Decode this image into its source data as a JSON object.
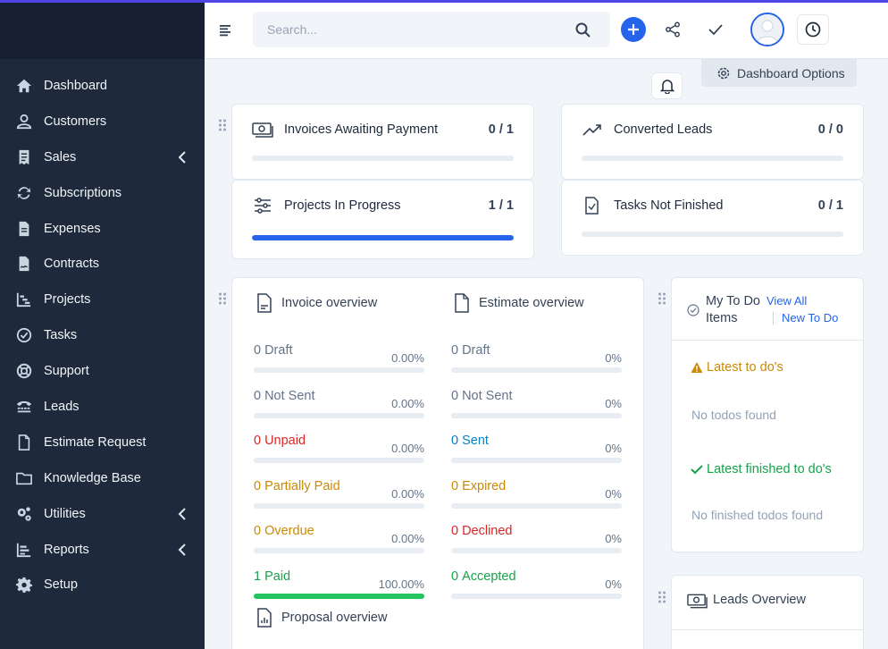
{
  "colors": {
    "sidebar": "#1e293b",
    "accent": "#2563eb",
    "danger": "#dc2626",
    "warning": "#ca8a04",
    "info": "#0284c7",
    "success": "#16a34a"
  },
  "sidebar": {
    "items": [
      {
        "label": "Dashboard",
        "icon": "home-icon"
      },
      {
        "label": "Customers",
        "icon": "user-icon"
      },
      {
        "label": "Sales",
        "icon": "receipt-icon",
        "submenu": true
      },
      {
        "label": "Subscriptions",
        "icon": "refresh-icon"
      },
      {
        "label": "Expenses",
        "icon": "file-icon"
      },
      {
        "label": "Contracts",
        "icon": "contract-icon"
      },
      {
        "label": "Projects",
        "icon": "chart-icon"
      },
      {
        "label": "Tasks",
        "icon": "check-circle-icon"
      },
      {
        "label": "Support",
        "icon": "lifebuoy-icon"
      },
      {
        "label": "Leads",
        "icon": "tty-icon"
      },
      {
        "label": "Estimate Request",
        "icon": "document-icon"
      },
      {
        "label": "Knowledge Base",
        "icon": "folder-icon"
      },
      {
        "label": "Utilities",
        "icon": "cogs-icon",
        "submenu": true
      },
      {
        "label": "Reports",
        "icon": "chart-bar-icon",
        "submenu": true
      },
      {
        "label": "Setup",
        "icon": "gear-icon"
      }
    ]
  },
  "topbar": {
    "search_placeholder": "Search..."
  },
  "dashboard_options": "Dashboard Options",
  "stats": [
    {
      "title": "Invoices Awaiting Payment",
      "value": "0 / 1",
      "progress": 0
    },
    {
      "title": "Converted Leads",
      "value": "0 / 0",
      "progress": 0
    },
    {
      "title": "Projects In Progress",
      "value": "1 / 1",
      "progress": 100
    },
    {
      "title": "Tasks Not Finished",
      "value": "0 / 1",
      "progress": 0
    }
  ],
  "invoice_overview": {
    "title": "Invoice overview",
    "rows": [
      {
        "count": "0",
        "label": "Draft",
        "pct": "0.00%",
        "progress": 0
      },
      {
        "count": "0",
        "label": "Not Sent",
        "pct": "0.00%",
        "progress": 0
      },
      {
        "count": "0",
        "label": "Unpaid",
        "pct": "0.00%",
        "progress": 0
      },
      {
        "count": "0",
        "label": "Partially Paid",
        "pct": "0.00%",
        "progress": 0
      },
      {
        "count": "0",
        "label": "Overdue",
        "pct": "0.00%",
        "progress": 0
      },
      {
        "count": "1",
        "label": "Paid",
        "pct": "100.00%",
        "progress": 100
      }
    ]
  },
  "estimate_overview": {
    "title": "Estimate overview",
    "rows": [
      {
        "count": "0",
        "label": "Draft",
        "pct": "0%",
        "progress": 0
      },
      {
        "count": "0",
        "label": "Not Sent",
        "pct": "0%",
        "progress": 0
      },
      {
        "count": "0",
        "label": "Sent",
        "pct": "0%",
        "progress": 0
      },
      {
        "count": "0",
        "label": "Expired",
        "pct": "0%",
        "progress": 0
      },
      {
        "count": "0",
        "label": "Declined",
        "pct": "0%",
        "progress": 0
      },
      {
        "count": "0",
        "label": "Accepted",
        "pct": "0%",
        "progress": 0
      }
    ]
  },
  "proposal_overview": {
    "title": "Proposal overview"
  },
  "todo": {
    "title": "My To Do Items",
    "view_all": "View All",
    "new_todo": "New To Do",
    "latest": "Latest to do's",
    "latest_empty": "No todos found",
    "finished": "Latest finished to do's",
    "finished_empty": "No finished todos found"
  },
  "leads_overview": {
    "title": "Leads Overview"
  }
}
